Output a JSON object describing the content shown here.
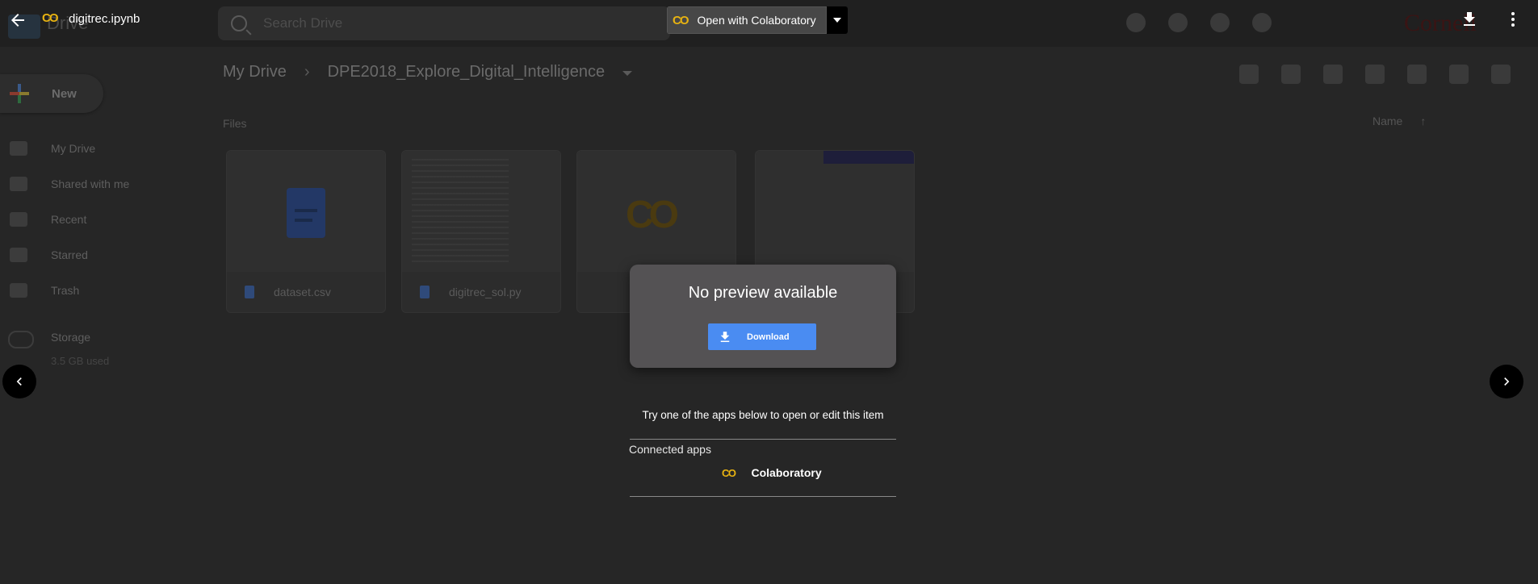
{
  "background": {
    "app_name": "Drive",
    "search_placeholder": "Search Drive",
    "brand_text": "Cornell",
    "new_button_label": "New",
    "nav_items": [
      {
        "label": "My Drive"
      },
      {
        "label": "Shared with me"
      },
      {
        "label": "Recent"
      },
      {
        "label": "Starred"
      },
      {
        "label": "Trash"
      }
    ],
    "storage_label": "Storage",
    "storage_used": "3.5 GB used",
    "breadcrumb": [
      "My Drive",
      "DPE2018_Explore_Digital_Intelligence"
    ],
    "files_label": "Files",
    "sort_label": "Name",
    "files": [
      {
        "name": "dataset.csv",
        "icon": "doc-icon"
      },
      {
        "name": "digitrec_sol.py",
        "icon": "doc-icon"
      },
      {
        "name": "",
        "icon": "colab-icon"
      },
      {
        "name": "",
        "icon": "notebook-thumbnail"
      }
    ]
  },
  "viewer": {
    "file_name": "digitrec.ipynb",
    "colab_glyph": "CO",
    "open_with_label": "Open with Colaboratory",
    "no_preview_text": "No preview available",
    "download_label": "Download",
    "try_apps_text": "Try one of the apps below to open or edit this item",
    "connected_apps_label": "Connected apps",
    "apps": [
      {
        "name": "Colaboratory",
        "icon": "colab-icon"
      }
    ],
    "accent_color": "#4a8cf2",
    "colab_color": "#e8b311"
  }
}
